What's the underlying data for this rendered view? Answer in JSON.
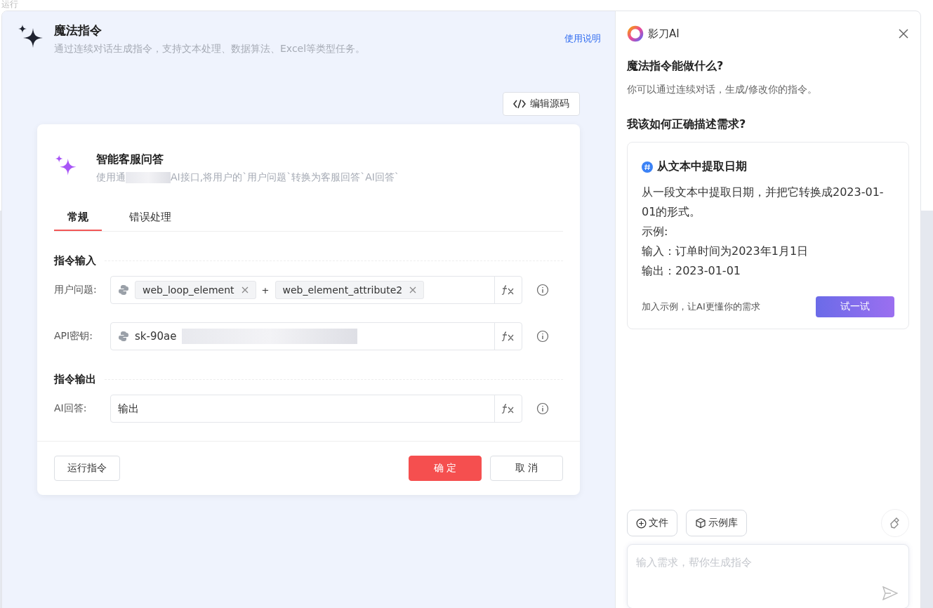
{
  "background": {
    "label": "运行"
  },
  "header": {
    "title": "魔法指令",
    "subtitle": "通过连续对话生成指令，支持文本处理、数据算法、Excel等类型任务。",
    "help_link": "使用说明"
  },
  "edit_source_button": "编辑源码",
  "card": {
    "title": "智能客服问答",
    "description_start": "使用通",
    "description_rest": "AI接口,将用户的`用户问题`转换为客服回答`AI回答`",
    "tabs": [
      {
        "label": "常规",
        "selected": true
      },
      {
        "label": "错误处理",
        "selected": false
      }
    ],
    "sections": [
      {
        "title": "指令输入",
        "fields": [
          {
            "label": "用户问题:",
            "kind": "tokens",
            "tokens": [
              "web_loop_element",
              "web_element_attribute2"
            ],
            "joiner": "+"
          },
          {
            "label": "API密钥:",
            "kind": "secret",
            "value": "sk-90ae"
          }
        ]
      },
      {
        "title": "指令输出",
        "fields": [
          {
            "label": "AI回答:",
            "kind": "plain",
            "value": "输出"
          }
        ]
      }
    ],
    "run_button": "运行指令",
    "confirm_button": "确 定",
    "cancel_button": "取 消"
  },
  "assistant": {
    "brand": "影刀AI",
    "q1": "魔法指令能做什么?",
    "a1": "你可以通过连续对话，生成/修改你的指令。",
    "q2": "我该如何正确描述需求?",
    "example": {
      "title": "从文本中提取日期",
      "lines": [
        "从一段文本中提取日期，并把它转换成2023-01-01的形式。",
        "示例:",
        "输入：订单时间为2023年1月1日",
        "输出：2023-01-01"
      ],
      "hint": "加入示例，让AI更懂你的需求",
      "try_button": "试一试"
    },
    "file_button": "文件",
    "library_button": "示例库",
    "input_placeholder": "输入需求，帮你生成指令"
  }
}
